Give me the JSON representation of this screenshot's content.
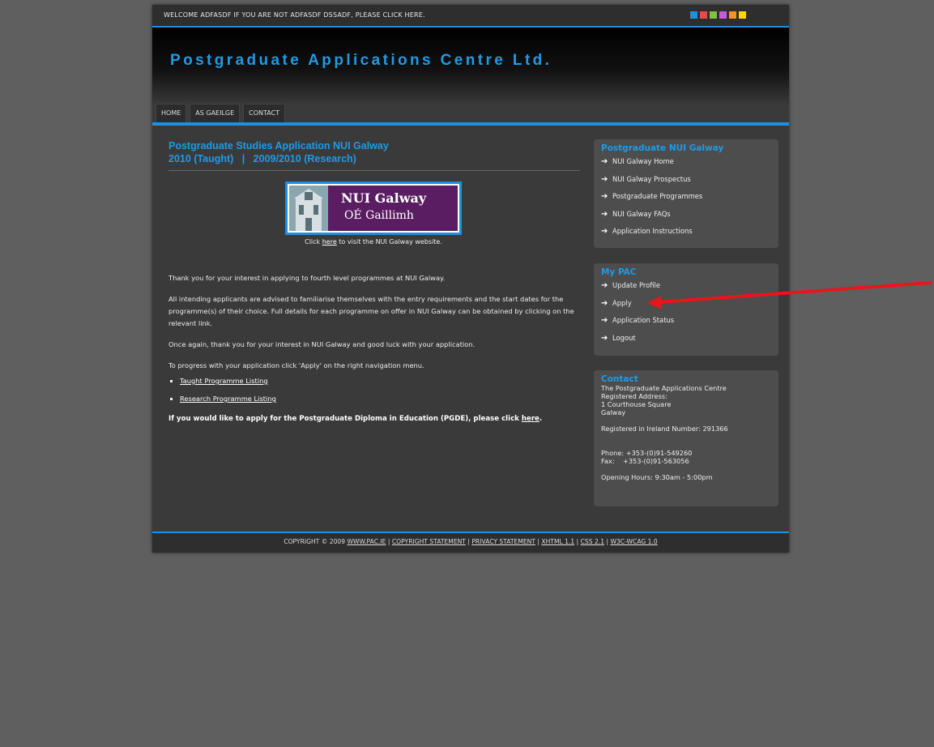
{
  "topbar": {
    "welcome": "WELCOME ADFASDF IF YOU ARE NOT ADFASDF DSSADF, PLEASE CLICK HERE.",
    "swatch_colors": [
      "#1e90e0",
      "#e84a4a",
      "#7dc242",
      "#c85ad8",
      "#f7931e",
      "#ffd400"
    ]
  },
  "header": {
    "title": "Postgraduate Applications Centre Ltd."
  },
  "nav": {
    "items": [
      "HOME",
      "AS GAEILGE",
      "CONTACT"
    ]
  },
  "main": {
    "heading_line1": "Postgraduate Studies Application NUI Galway",
    "heading_line2": "2010 (Taught)   |   2009/2010 (Research)",
    "logo": {
      "line1": "NUI Galway",
      "line2": "OÉ Gaillimh"
    },
    "logo_caption_pre": "Click ",
    "logo_caption_link": "here",
    "logo_caption_post": " to visit the NUI Galway website.",
    "p1": "Thank you for your interest in applying to fourth level programmes at NUI Galway.",
    "p2": "All intending applicants are advised to familiarise themselves with the entry requirements and the start dates for the programme(s) of their choice. Full details for each programme on offer in NUI Galway can be obtained by clicking on the relevant link.",
    "p3": "Once again, thank you for your interest in NUI Galway and good luck with your application.",
    "p4": "To progress with your application click 'Apply' on the right navigation menu.",
    "links": [
      "Taught Programme Listing",
      "Research Programme Listing"
    ],
    "pgde_text": "If you would like to apply for the Postgraduate Diploma in Education (PGDE), please click ",
    "pgde_link": "here",
    "pgde_end": "."
  },
  "sidebar": {
    "nui": {
      "title": "Postgraduate NUI Galway",
      "items": [
        "NUI Galway Home",
        "NUI Galway Prospectus",
        "Postgraduate Programmes",
        "NUI Galway FAQs",
        "Application Instructions"
      ]
    },
    "mypac": {
      "title": "My PAC",
      "items": [
        "Update Profile",
        "Apply",
        "Application Status",
        "Logout"
      ]
    },
    "contact": {
      "title": "Contact",
      "lines": [
        "The Postgraduate Applications Centre",
        "Registered Address:",
        "1 Courthouse Square",
        "Galway",
        "",
        "Registered in Ireland Number: 291366",
        "",
        "",
        "Phone: +353-(0)91-549260",
        "Fax:    +353-(0)91-563056",
        "",
        "Opening Hours: 9:30am - 5:00pm"
      ]
    }
  },
  "footer": {
    "prefix": "COPYRIGHT © 2009",
    "links": [
      "WWW.PAC.IE",
      "COPYRIGHT STATEMENT",
      "PRIVACY STATEMENT",
      "XHTML 1.1",
      "CSS 2.1",
      "W3C-WCAG 1.0"
    ]
  },
  "annotation": {
    "color": "#e8161b"
  }
}
